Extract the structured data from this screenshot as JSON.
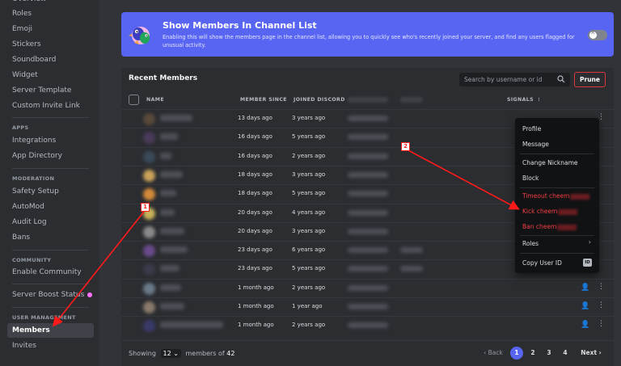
{
  "sidebar": {
    "items": [
      {
        "label": "Overview"
      },
      {
        "label": "Roles"
      },
      {
        "label": "Emoji"
      },
      {
        "label": "Stickers"
      },
      {
        "label": "Soundboard"
      },
      {
        "label": "Widget"
      },
      {
        "label": "Server Template"
      },
      {
        "label": "Custom Invite Link"
      }
    ],
    "apps_heading": "APPS",
    "apps_items": [
      {
        "label": "Integrations"
      },
      {
        "label": "App Directory"
      }
    ],
    "moderation_heading": "MODERATION",
    "moderation_items": [
      {
        "label": "Safety Setup"
      },
      {
        "label": "AutoMod"
      },
      {
        "label": "Audit Log"
      },
      {
        "label": "Bans"
      }
    ],
    "community_heading": "COMMUNITY",
    "community_items": [
      {
        "label": "Enable Community"
      }
    ],
    "boost_label": "Server Boost Status",
    "user_mgmt_heading": "USER MANAGEMENT",
    "user_mgmt_items": [
      {
        "label": "Members"
      },
      {
        "label": "Invites"
      }
    ]
  },
  "banner": {
    "title": "Show Members In Channel List",
    "description": "Enabling this will show the members page in the channel list, allowing you to quickly see who's recently joined your server, and find any users flagged for unusual activity.",
    "toggle_symbol": "✕"
  },
  "members": {
    "title": "Recent Members",
    "search_placeholder": "Search by username or id",
    "prune_label": "Prune",
    "columns": {
      "name": "NAME",
      "member_since": "MEMBER SINCE",
      "joined_discord": "JOINED DISCORD",
      "signals": "SIGNALS"
    },
    "rows": [
      {
        "since": "13 days ago",
        "joined": "3 years ago"
      },
      {
        "since": "16 days ago",
        "joined": "5 years ago"
      },
      {
        "since": "16 days ago",
        "joined": "2 years ago"
      },
      {
        "since": "18 days ago",
        "joined": "3 years ago"
      },
      {
        "since": "18 days ago",
        "joined": "5 years ago"
      },
      {
        "since": "20 days ago",
        "joined": "4 years ago"
      },
      {
        "since": "20 days ago",
        "joined": "3 years ago"
      },
      {
        "since": "23 days ago",
        "joined": "6 years ago"
      },
      {
        "since": "23 days ago",
        "joined": "5 years ago"
      },
      {
        "since": "1 month ago",
        "joined": "2 years ago"
      },
      {
        "since": "1 month ago",
        "joined": "1 year ago"
      },
      {
        "since": "1 month ago",
        "joined": "2 years ago"
      }
    ],
    "footer": {
      "showing_label": "Showing",
      "per_page": "12",
      "members_of_label": "members of",
      "total": "42",
      "back_label": "‹ Back",
      "pages": [
        "1",
        "2",
        "3",
        "4"
      ],
      "next_label": "Next ›"
    }
  },
  "context_menu": {
    "profile": "Profile",
    "message": "Message",
    "change_nickname": "Change Nickname",
    "block": "Block",
    "timeout": "Timeout cheem",
    "kick": "Kick cheem",
    "ban": "Ban cheem",
    "roles": "Roles",
    "copy_user_id": "Copy User ID",
    "id_badge": "ID"
  },
  "annotations": {
    "callout_1": "1",
    "callout_2": "2"
  },
  "colors": {
    "accent": "#5865f2",
    "danger": "#f23f43",
    "annotation": "#ff1a1a"
  }
}
